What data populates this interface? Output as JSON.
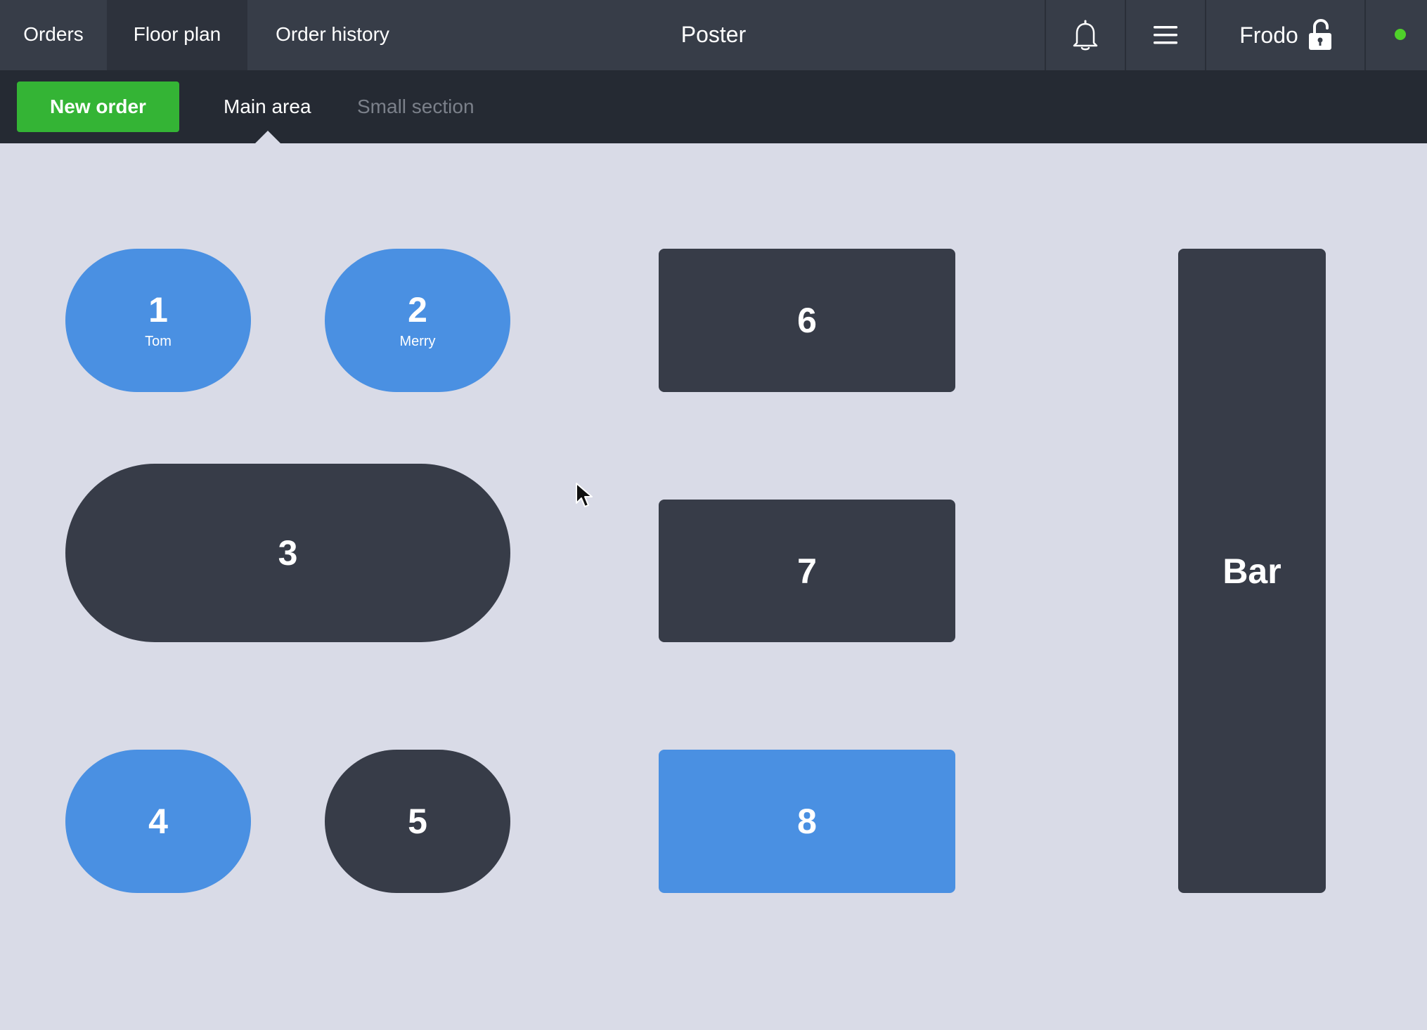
{
  "topbar": {
    "tabs": [
      {
        "label": "Orders"
      },
      {
        "label": "Floor plan"
      },
      {
        "label": "Order history"
      }
    ],
    "title": "Poster",
    "notification_icon": "bell-icon",
    "menu_icon": "hamburger-menu-icon",
    "user_name": "Frodo",
    "lock_icon": "unlocked-padlock-icon",
    "status_color": "#4fd12a"
  },
  "subbar": {
    "new_order_label": "New order",
    "sections": [
      {
        "label": "Main area"
      },
      {
        "label": "Small section"
      }
    ]
  },
  "colors": {
    "accent_green": "#34b435",
    "occupied_blue": "#4a90e2",
    "free_dark": "#373c48",
    "floor_background": "#d9dbe7"
  },
  "tables": [
    {
      "number": "1",
      "guest": "Tom",
      "status": "occupied"
    },
    {
      "number": "2",
      "guest": "Merry",
      "status": "occupied"
    },
    {
      "number": "3",
      "guest": "",
      "status": "free"
    },
    {
      "number": "4",
      "guest": "",
      "status": "occupied"
    },
    {
      "number": "5",
      "guest": "",
      "status": "free"
    },
    {
      "number": "6",
      "guest": "",
      "status": "free"
    },
    {
      "number": "7",
      "guest": "",
      "status": "free"
    },
    {
      "number": "8",
      "guest": "",
      "status": "occupied"
    },
    {
      "number": "Bar",
      "guest": "",
      "status": "free"
    }
  ]
}
